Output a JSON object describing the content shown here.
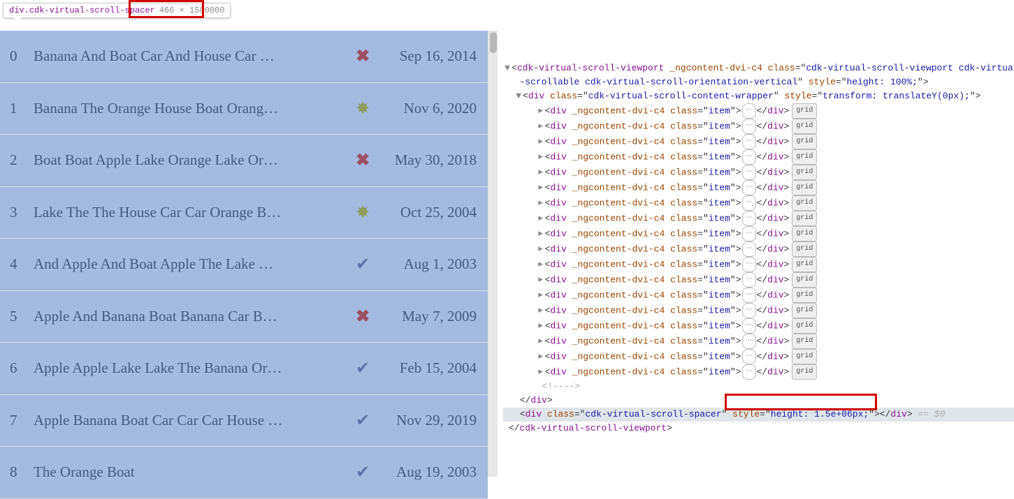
{
  "tooltip": {
    "selector": "div.cdk-virtual-scroll-spacer",
    "dims": "466 × 1500000"
  },
  "list": {
    "rows": [
      {
        "idx": "0",
        "title": "Banana And Boat Car And House Car …",
        "icon": "x",
        "date": "Sep 16, 2014"
      },
      {
        "idx": "1",
        "title": "Banana The Orange House Boat Orang…",
        "icon": "star",
        "date": "Nov 6, 2020"
      },
      {
        "idx": "2",
        "title": "Boat Boat Apple Lake Orange Lake Or…",
        "icon": "x",
        "date": "May 30, 2018"
      },
      {
        "idx": "3",
        "title": "Lake The The House Car Car Orange B…",
        "icon": "star",
        "date": "Oct 25, 2004"
      },
      {
        "idx": "4",
        "title": "And Apple And Boat Apple The Lake …",
        "icon": "check",
        "date": "Aug 1, 2003"
      },
      {
        "idx": "5",
        "title": "Apple And Banana Boat Banana Car B…",
        "icon": "x",
        "date": "May 7, 2009"
      },
      {
        "idx": "6",
        "title": "Apple Apple Lake Lake The Banana Or…",
        "icon": "check",
        "date": "Feb 15, 2004"
      },
      {
        "idx": "7",
        "title": "Apple Banana Boat Car Car Car House …",
        "icon": "check",
        "date": "Nov 29, 2019"
      },
      {
        "idx": "8",
        "title": "The Orange Boat",
        "icon": "check",
        "date": "Aug 19, 2003"
      }
    ]
  },
  "dom": {
    "viewport_tag": "cdk-virtual-scroll-viewport",
    "viewport_ng": "_ngcontent-dvi-c4",
    "viewport_class": "cdk-virtual-scroll-viewport cdk-virtual-scrollable cdk-virtual-scroll-orientation-vertical",
    "viewport_style": "height: 100%;",
    "wrapper_class": "cdk-virtual-scroll-content-wrapper",
    "wrapper_style": "transform: translateY(0px);",
    "item_ng": "_ngcontent-dvi-c4",
    "item_class": "item",
    "item_count": 18,
    "grid_label": "grid",
    "comment": "<!---->",
    "spacer_class": "cdk-virtual-scroll-spacer",
    "spacer_style": "height: 1.5e+06px;",
    "eq0": " == $0"
  }
}
